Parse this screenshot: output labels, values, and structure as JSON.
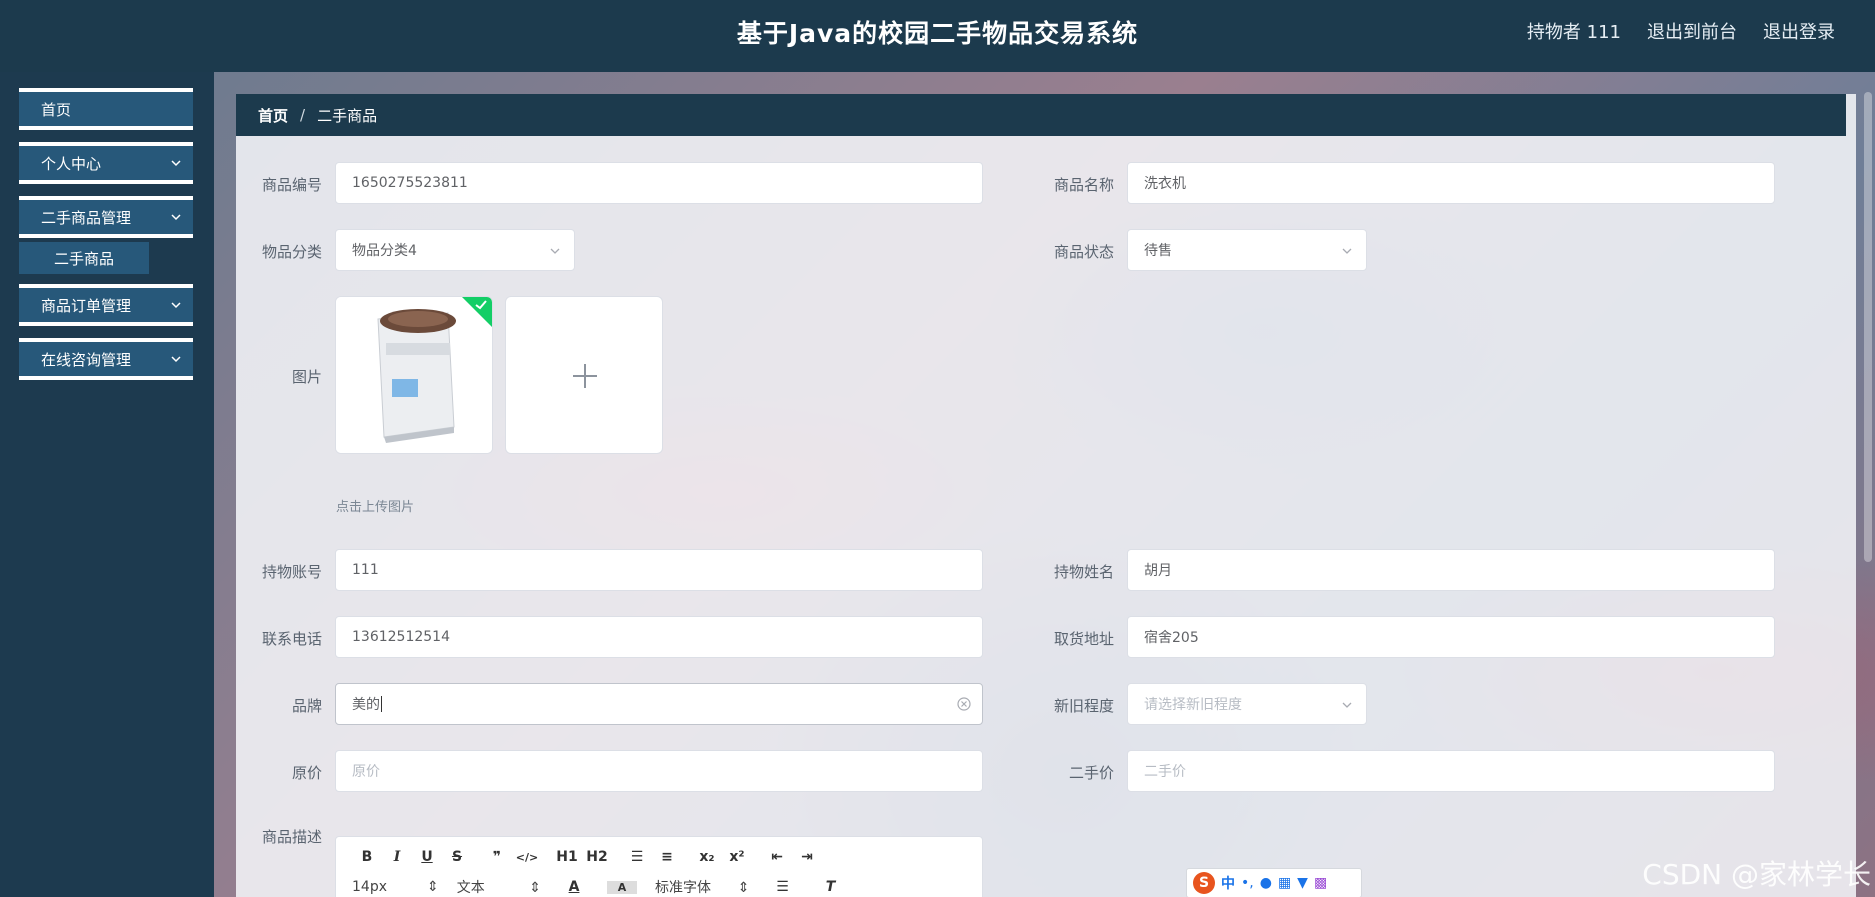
{
  "app": {
    "title": "基于Java的校园二手物品交易系统"
  },
  "header": {
    "user_label": "持物者 111",
    "to_front": "退出到前台",
    "logout": "退出登录"
  },
  "sidebar": {
    "home": "首页",
    "personal": "个人中心",
    "goods_mgmt": "二手商品管理",
    "goods_sub": "二手商品",
    "orders": "商品订单管理",
    "consult": "在线咨询管理"
  },
  "breadcrumb": {
    "home": "首页",
    "sep": "/",
    "current": "二手商品"
  },
  "form": {
    "code": {
      "label": "商品编号",
      "value": "1650275523811"
    },
    "name": {
      "label": "商品名称",
      "value": "洗衣机"
    },
    "category": {
      "label": "物品分类",
      "value": "物品分类4"
    },
    "status": {
      "label": "商品状态",
      "value": "待售"
    },
    "image": {
      "label": "图片",
      "tip": "点击上传图片"
    },
    "account": {
      "label": "持物账号",
      "value": "111"
    },
    "owner_name": {
      "label": "持物姓名",
      "value": "胡月"
    },
    "phone": {
      "label": "联系电话",
      "value": "13612512514"
    },
    "address": {
      "label": "取货地址",
      "value": "宿舍205"
    },
    "brand": {
      "label": "品牌",
      "value": "美的"
    },
    "condition": {
      "label": "新旧程度",
      "placeholder": "请选择新旧程度"
    },
    "orig_price": {
      "label": "原价",
      "placeholder": "原价"
    },
    "second_price": {
      "label": "二手价",
      "placeholder": "二手价"
    },
    "description": {
      "label": "商品描述"
    }
  },
  "editor": {
    "font_size": "14px",
    "header_type": "文本",
    "font_family": "标准字体",
    "buttons": {
      "bold": "B",
      "italic": "I",
      "underline": "U",
      "strike": "S",
      "h1": "H1",
      "h2": "H2",
      "sub": "x₂",
      "sup": "x²"
    }
  },
  "ime": {
    "lang": "中"
  },
  "watermark": "CSDN @家林学长",
  "colors": {
    "header": "#1c3a4d",
    "menu": "#27587a",
    "success": "#13ce66"
  }
}
